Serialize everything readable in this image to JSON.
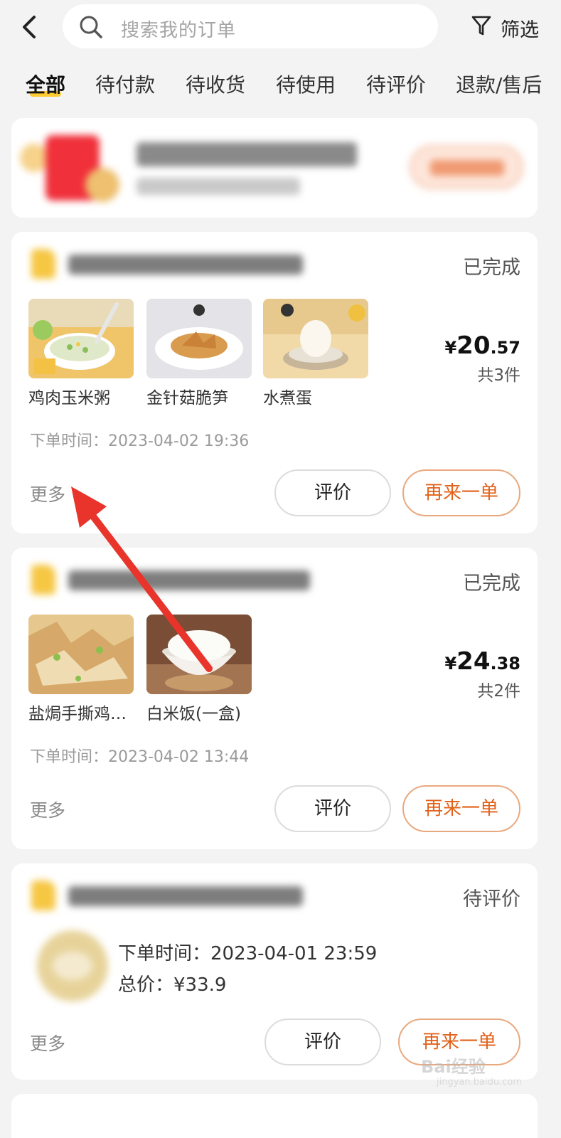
{
  "search": {
    "placeholder": "搜索我的订单"
  },
  "filter": {
    "label": "筛选"
  },
  "tabs": [
    {
      "label": "全部",
      "active": true
    },
    {
      "label": "待付款"
    },
    {
      "label": "待收货"
    },
    {
      "label": "待使用"
    },
    {
      "label": "待评价"
    },
    {
      "label": "退款/售后"
    }
  ],
  "orders": [
    {
      "status": "已完成",
      "items": [
        {
          "name": "鸡肉玉米粥"
        },
        {
          "name": "金针菇脆笋"
        },
        {
          "name": "水煮蛋"
        }
      ],
      "price_currency": "¥",
      "price_int": "20",
      "price_dec": ".57",
      "qty": "共3件",
      "time": "下单时间：2023-04-02 19:36",
      "more": "更多",
      "review": "评价",
      "again": "再来一单"
    },
    {
      "status": "已完成",
      "items": [
        {
          "name": "盐焗手撕鸡…"
        },
        {
          "name": "白米饭(一盒)"
        }
      ],
      "price_currency": "¥",
      "price_int": "24",
      "price_dec": ".38",
      "qty": "共2件",
      "time": "下单时间：2023-04-02 13:44",
      "more": "更多",
      "review": "评价",
      "again": "再来一单"
    },
    {
      "status": "待评价",
      "time": "下单时间：2023-04-01 23:59",
      "total": "总价：¥33.9",
      "more": "更多",
      "review": "评价",
      "again": "再来一单"
    }
  ],
  "watermark": {
    "brand": "Bai经验",
    "url": "jingyan.baidu.com"
  },
  "colors": {
    "accent": "#e2621a",
    "tab_underline": "#ffcc33",
    "arrow": "#e8342a"
  }
}
